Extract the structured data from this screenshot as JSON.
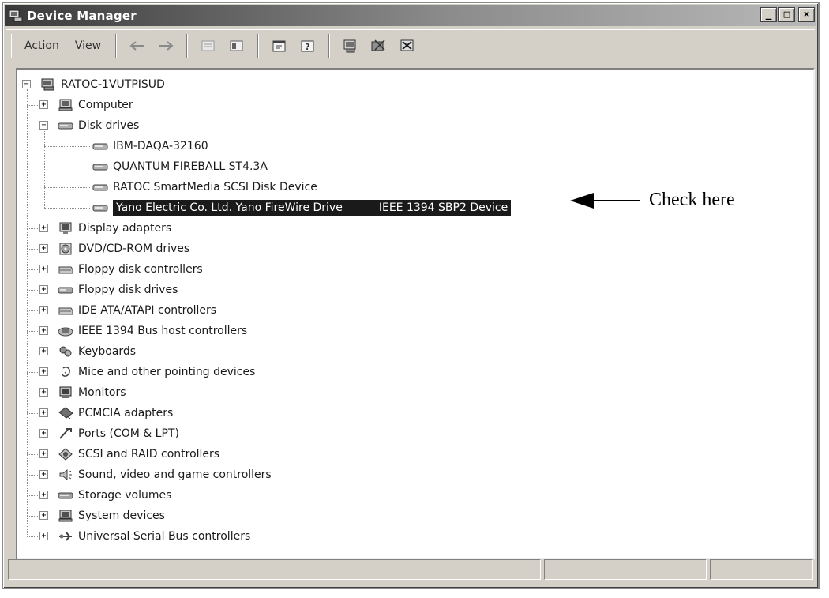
{
  "window": {
    "title": "Device Manager",
    "caption_buttons": [
      "_",
      "□",
      "×"
    ]
  },
  "menu": {
    "action": "Action",
    "view": "View"
  },
  "toolbar_icons": [
    "back-arrow-icon",
    "forward-arrow-icon",
    "up-folder-icon",
    "show-hide-tree-icon",
    "properties-icon",
    "help-icon",
    "scan-hardware-icon",
    "update-driver-icon",
    "uninstall-icon"
  ],
  "tree": {
    "root": "RATOC-1VUTPISUD",
    "categories": [
      {
        "label": "Computer",
        "icon": "computer-icon"
      },
      {
        "label": "Disk drives",
        "icon": "disk-drive-icon",
        "expanded": true,
        "children": [
          {
            "label": "IBM-DAQA-32160"
          },
          {
            "label": "QUANTUM FIREBALL ST4.3A"
          },
          {
            "label": "RATOC SmartMedia SCSI Disk Device"
          },
          {
            "label": "Yano Electric Co.  Ltd. Yano FireWire Drive",
            "extra": "IEEE 1394 SBP2 Device",
            "selected": true
          }
        ]
      },
      {
        "label": "Display adapters",
        "icon": "display-icon"
      },
      {
        "label": "DVD/CD-ROM drives",
        "icon": "cdrom-icon"
      },
      {
        "label": "Floppy disk controllers",
        "icon": "controller-icon"
      },
      {
        "label": "Floppy disk drives",
        "icon": "floppy-icon"
      },
      {
        "label": "IDE ATA/ATAPI controllers",
        "icon": "controller-icon"
      },
      {
        "label": "IEEE 1394 Bus host controllers",
        "icon": "ieee1394-icon"
      },
      {
        "label": "Keyboards",
        "icon": "keyboard-icon"
      },
      {
        "label": "Mice and other pointing devices",
        "icon": "mouse-icon"
      },
      {
        "label": "Monitors",
        "icon": "monitor-icon"
      },
      {
        "label": "PCMCIA adapters",
        "icon": "pcmcia-icon"
      },
      {
        "label": "Ports (COM & LPT)",
        "icon": "port-icon"
      },
      {
        "label": "SCSI and RAID controllers",
        "icon": "scsi-icon"
      },
      {
        "label": "Sound, video and game controllers",
        "icon": "sound-icon"
      },
      {
        "label": "Storage volumes",
        "icon": "storage-icon"
      },
      {
        "label": "System devices",
        "icon": "system-icon"
      },
      {
        "label": "Universal Serial Bus controllers",
        "icon": "usb-icon"
      }
    ]
  },
  "callout": {
    "text": "Check here"
  }
}
